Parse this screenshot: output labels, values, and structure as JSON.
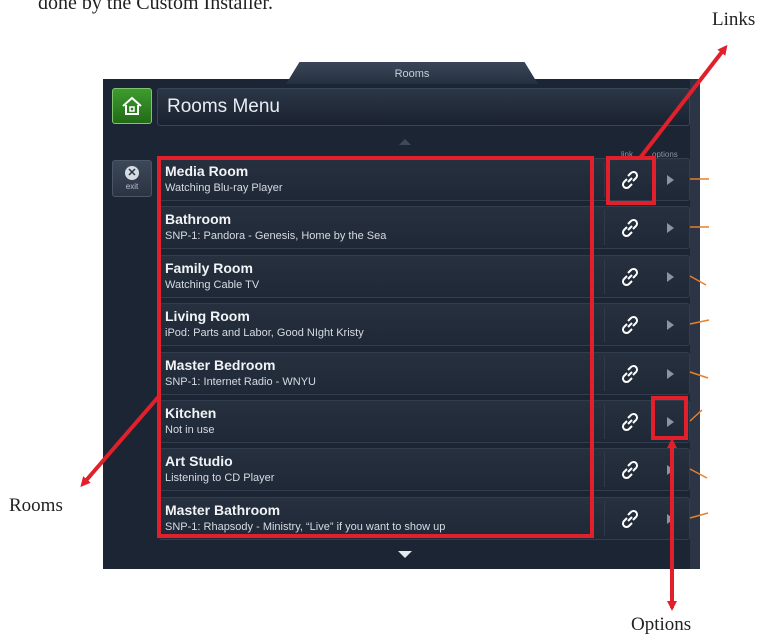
{
  "document": {
    "intro_fragment": "done by the Custom Installer."
  },
  "window": {
    "tab_title": "Rooms",
    "title": "Rooms Menu"
  },
  "exit": {
    "label": "exit"
  },
  "columns": {
    "link": "link",
    "options": "options"
  },
  "rooms": [
    {
      "name": "Media Room",
      "status": "Watching Blu-ray Player"
    },
    {
      "name": "Bathroom",
      "status": "SNP-1: Pandora - Genesis, Home by the Sea"
    },
    {
      "name": "Family Room",
      "status": "Watching Cable TV"
    },
    {
      "name": "Living Room",
      "status": "iPod: Parts and Labor, Good NIght Kristy"
    },
    {
      "name": "Master Bedroom",
      "status": "SNP-1: Internet Radio - WNYU"
    },
    {
      "name": "Kitchen",
      "status": "Not in use"
    },
    {
      "name": "Art Studio",
      "status": "Listening to CD Player"
    },
    {
      "name": "Master Bathroom",
      "status": "SNP-1: Rhapsody - Ministry, “Live” if you want to show up"
    }
  ],
  "callouts": {
    "links": "Links",
    "rooms": "Rooms",
    "options": "Options"
  },
  "icons": {
    "home": "home-icon",
    "exit": "close-circle-icon",
    "link": "chain-link-icon",
    "option": "play-arrow-icon"
  },
  "colors": {
    "highlight_red": "#e0202a",
    "connector_orange": "#e6802b",
    "home_green": "#2f8a22",
    "panel_bg": "#1c2533"
  }
}
